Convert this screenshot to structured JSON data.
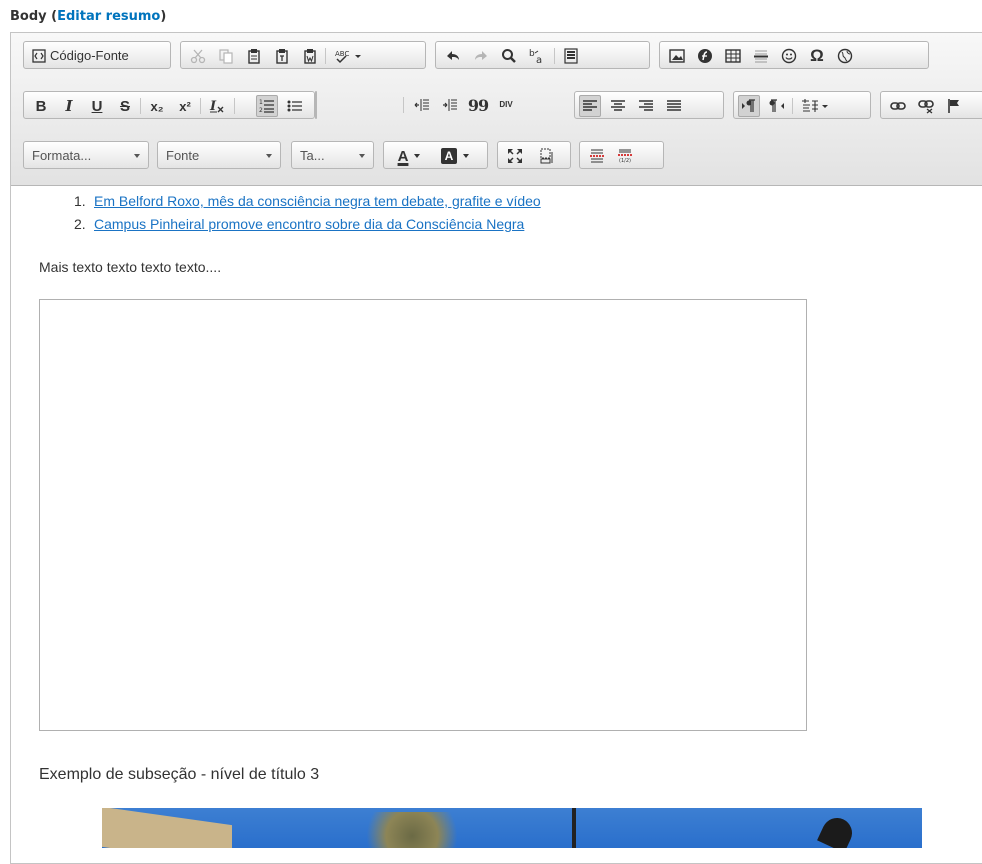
{
  "field": {
    "label": "Body",
    "open_paren": " (",
    "summary_link": "Editar resumo",
    "close_paren": ")"
  },
  "toolbar": {
    "source_label": "Código-Fonte",
    "format_label": "Formata...",
    "font_label": "Fonte",
    "size_label": "Ta...",
    "bold_glyph": "B",
    "italic_glyph": "I",
    "underline_glyph": "U",
    "strike_glyph": "S",
    "sub_glyph": "x₂",
    "sup_glyph": "x²",
    "removeformat_glyph": "Ix",
    "quote_glyph": "99",
    "div_glyph": "DIV",
    "omega_glyph": "Ω",
    "font_color_glyph": "A",
    "bg_color_glyph": "A"
  },
  "content": {
    "list": [
      {
        "num": "1.",
        "text": "Em Belford Roxo, mês da consciência negra tem debate, grafite e vídeo"
      },
      {
        "num": "2.",
        "text": "Campus Pinheiral promove encontro sobre dia da Consciência Negra"
      }
    ],
    "paragraph": "Mais texto texto texto texto....",
    "subheading": "Exemplo de subseção - nível de título 3"
  },
  "colors": {
    "link": "#1a73c4",
    "label_link": "#0074bd",
    "toolbar_bg": "#e9e9e9"
  }
}
